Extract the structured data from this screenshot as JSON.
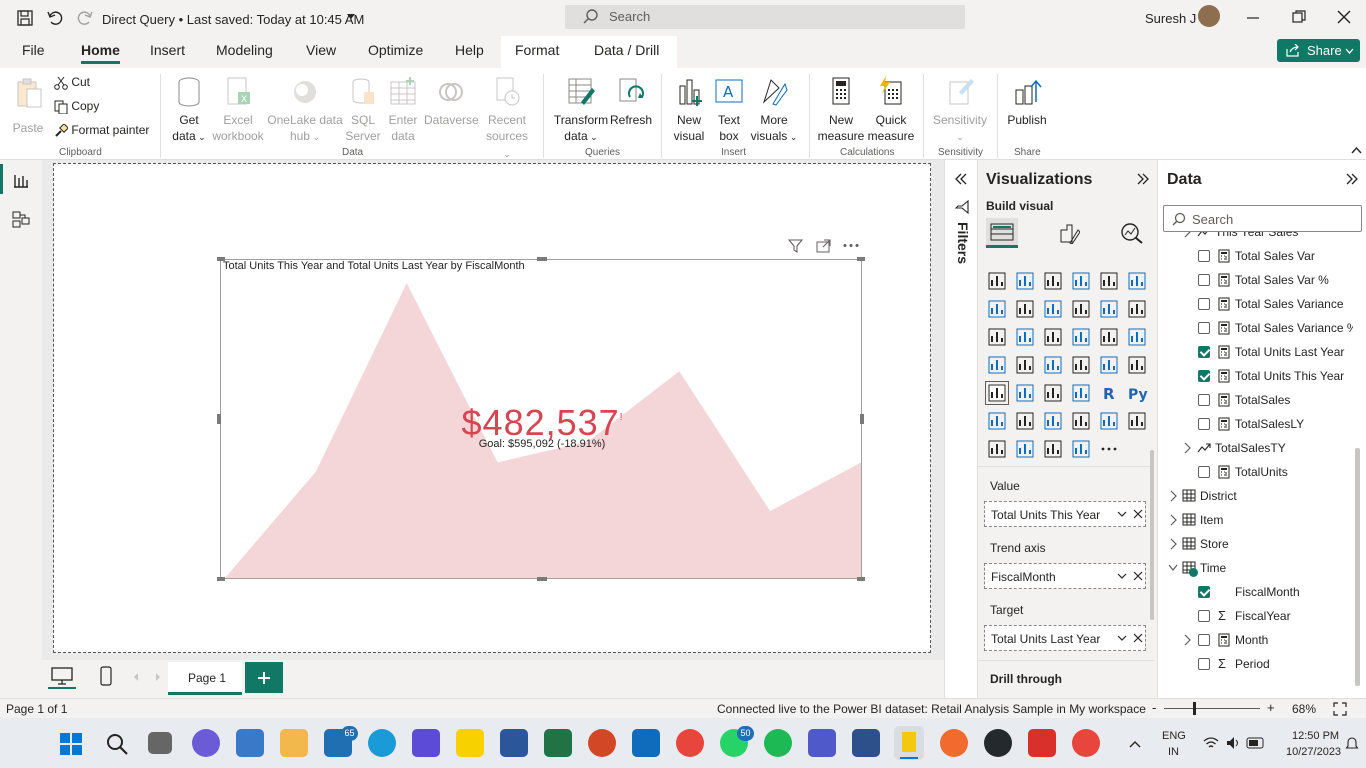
{
  "titlebar": {
    "title": "Direct Query • Last saved: Today at 10:45 AM",
    "search_placeholder": "Search",
    "user_name": "Suresh J"
  },
  "menu": {
    "tabs": [
      "File",
      "Home",
      "Insert",
      "Modeling",
      "View",
      "Optimize",
      "Help",
      "Format",
      "Data / Drill"
    ],
    "active": "Home",
    "share_label": "Share"
  },
  "ribbon": {
    "paste": "Paste",
    "cut": "Cut",
    "copy": "Copy",
    "format_painter": "Format painter",
    "clipboard_group": "Clipboard",
    "get_data_1": "Get",
    "get_data_2": "data",
    "excel_1": "Excel",
    "excel_2": "workbook",
    "onelake_1": "OneLake data",
    "onelake_2": "hub",
    "sql_1": "SQL",
    "sql_2": "Server",
    "enter_1": "Enter",
    "enter_2": "data",
    "dataverse": "Dataverse",
    "recent_1": "Recent",
    "recent_2": "sources",
    "data_group": "Data",
    "transform_1": "Transform",
    "transform_2": "data",
    "refresh": "Refresh",
    "queries_group": "Queries",
    "newvisual_1": "New",
    "newvisual_2": "visual",
    "textbox_1": "Text",
    "textbox_2": "box",
    "morevisuals_1": "More",
    "morevisuals_2": "visuals",
    "insert_group": "Insert",
    "newmeasure_1": "New",
    "newmeasure_2": "measure",
    "quickmeasure_1": "Quick",
    "quickmeasure_2": "measure",
    "calculations_group": "Calculations",
    "sensitivity": "Sensitivity",
    "sensitivity_group": "Sensitivity",
    "publish": "Publish",
    "share_group": "Share"
  },
  "visual": {
    "title": "Total Units This Year and Total Units Last Year by FiscalMonth",
    "kpi_value": "$482,537",
    "kpi_indicator": "!",
    "goal_text": "Goal: $595,092 (-18.91%)",
    "area_color": "#f4d5d8",
    "kpi_color": "#d64550"
  },
  "chart_data": {
    "type": "area",
    "x": [
      1,
      2,
      3,
      4,
      5,
      6,
      7,
      8
    ],
    "values": [
      0,
      0.35,
      0.97,
      0.38,
      0.45,
      0.68,
      0.22,
      0.38
    ],
    "title": "Total Units This Year and Total Units Last Year by FiscalMonth"
  },
  "filters": {
    "label": "Filters"
  },
  "viz_pane": {
    "title": "Visualizations",
    "build_visual": "Build visual",
    "wells": [
      {
        "header": "Value",
        "field": "Total Units This Year"
      },
      {
        "header": "Trend axis",
        "field": "FiscalMonth"
      },
      {
        "header": "Target",
        "field": "Total Units Last Year"
      }
    ],
    "drill_through": "Drill through"
  },
  "data_pane": {
    "title": "Data",
    "search_placeholder": "Search",
    "items": [
      {
        "label": "This Year Sales",
        "kind": "trend",
        "checked": false,
        "level": 1,
        "expander": true
      },
      {
        "label": "Total Sales Var",
        "kind": "measure",
        "checked": false,
        "level": 2
      },
      {
        "label": "Total Sales Var %",
        "kind": "measure",
        "checked": false,
        "level": 2
      },
      {
        "label": "Total Sales Variance",
        "kind": "measure",
        "checked": false,
        "level": 2
      },
      {
        "label": "Total Sales Variance %",
        "kind": "measure",
        "checked": false,
        "level": 2
      },
      {
        "label": "Total Units Last Year",
        "kind": "measure",
        "checked": true,
        "level": 2
      },
      {
        "label": "Total Units This Year",
        "kind": "measure",
        "checked": true,
        "level": 2
      },
      {
        "label": "TotalSales",
        "kind": "measure",
        "checked": false,
        "level": 2
      },
      {
        "label": "TotalSalesLY",
        "kind": "measure",
        "checked": false,
        "level": 2
      },
      {
        "label": "TotalSalesTY",
        "kind": "trend",
        "checked": false,
        "level": 1,
        "expander": true
      },
      {
        "label": "TotalUnits",
        "kind": "measure",
        "checked": false,
        "level": 2
      },
      {
        "label": "District",
        "kind": "table",
        "level": 0
      },
      {
        "label": "Item",
        "kind": "table",
        "level": 0
      },
      {
        "label": "Store",
        "kind": "table",
        "level": 0
      },
      {
        "label": "Time",
        "kind": "table-open",
        "level": 0
      },
      {
        "label": "FiscalMonth",
        "kind": "field",
        "checked": true,
        "level": 2
      },
      {
        "label": "FiscalYear",
        "kind": "sigma",
        "checked": false,
        "level": 2
      },
      {
        "label": "Month",
        "kind": "measure",
        "checked": false,
        "level": 2,
        "expander": true
      },
      {
        "label": "Period",
        "kind": "sigma",
        "checked": false,
        "level": 2
      }
    ]
  },
  "pages": {
    "current": "Page 1"
  },
  "status": {
    "page_info": "Page 1 of 1",
    "connection": "Connected live to the Power BI dataset: Retail Analysis Sample in My workspace",
    "zoom": "68%"
  },
  "taskbar": {
    "badge_mail": "65",
    "badge_whatsapp": "50",
    "lang_1": "ENG",
    "lang_2": "IN",
    "time": "12:50 PM",
    "date": "10/27/2023"
  }
}
